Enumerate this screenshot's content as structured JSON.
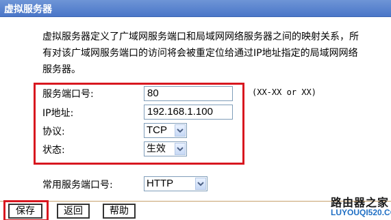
{
  "window": {
    "title": "虚拟服务器"
  },
  "description": "虚拟服务器定义了广域网服务端口和局域网网络服务器之间的映射关系，所有对该广域网服务端口的访问将会被重定位给通过IP地址指定的局域网网络服务器。",
  "form": {
    "service_port": {
      "label": "服务端口号:",
      "value": "80",
      "hint": "(XX-XX or XX)"
    },
    "ip_address": {
      "label": "IP地址:",
      "value": "192.168.1.100"
    },
    "protocol": {
      "label": "协议:",
      "selected": "TCP"
    },
    "status": {
      "label": "状态:",
      "selected": "生效"
    },
    "common_port": {
      "label": "常用服务端口号:",
      "selected": "HTTP"
    }
  },
  "buttons": {
    "save": "保存",
    "back": "返回",
    "help": "帮助"
  },
  "watermark": {
    "name": "路由器之家",
    "url": "LUYOUQI520.COM"
  },
  "colors": {
    "highlight_red": "#d8171f",
    "title_blue": "#4a76c8",
    "watermark_blue": "#1f6fc4"
  }
}
